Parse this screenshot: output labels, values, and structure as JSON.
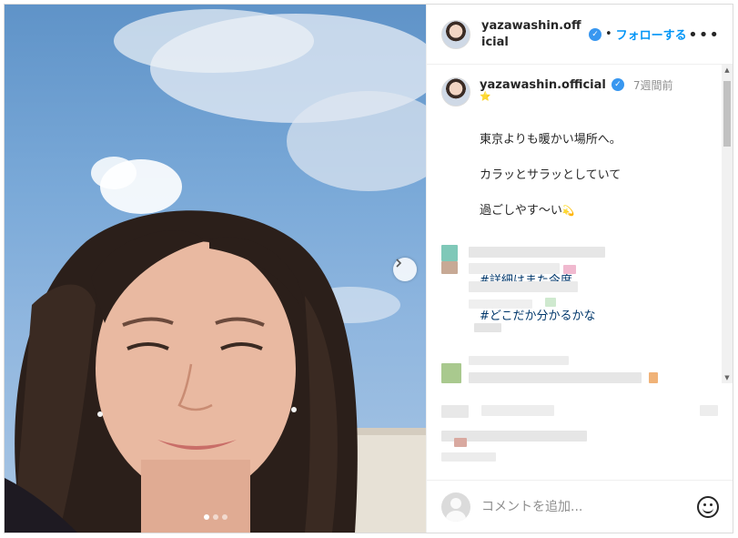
{
  "post": {
    "username": "yazawashin.official",
    "follow_separator": "•",
    "follow_label": "フォローする",
    "more_label": "•••",
    "verified_mark": "✓"
  },
  "caption": {
    "username": "yazawashin.official",
    "time_ago": "7週間前",
    "star": "⭐",
    "line1": "東京よりも暖かい場所へ。",
    "line2": "カラッとサラッとしていて",
    "line3": "過ごしやす〜い",
    "emoji": "💫",
    "hashtag1": "#詳細はまた今度",
    "hashtag2": "#どこだか分かるかな"
  },
  "carousel": {
    "dot_count": 3,
    "active_index": 0,
    "next_icon": "chevron-right-icon"
  },
  "add_comment": {
    "placeholder": "コメントを追加..."
  },
  "colors": {
    "link_blue": "#0095f6",
    "hashtag": "#00376b",
    "verified": "#3897f0"
  }
}
